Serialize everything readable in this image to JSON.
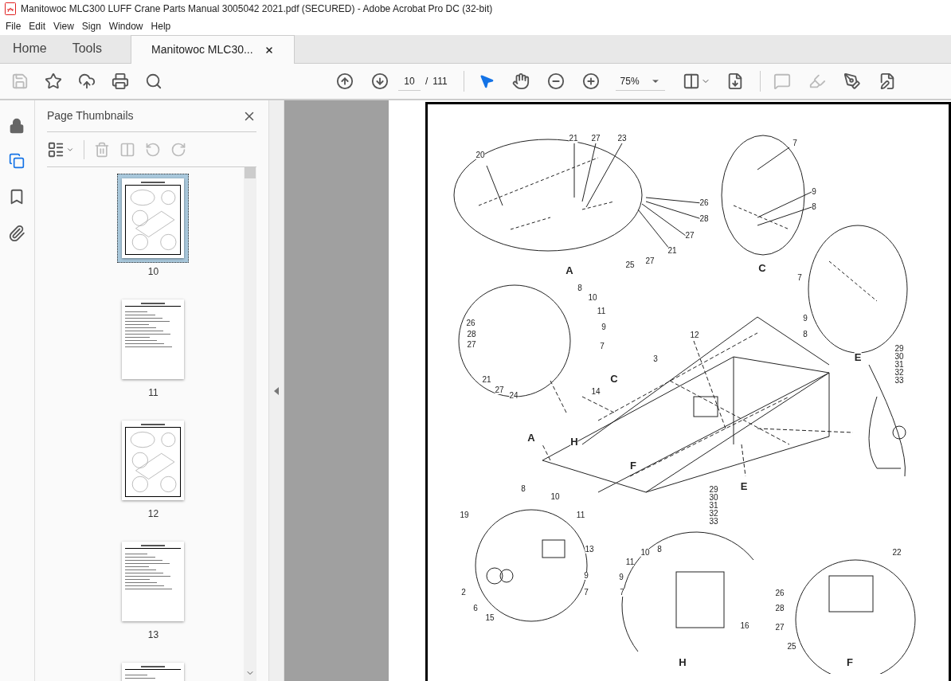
{
  "window": {
    "title": "Manitowoc MLC300 LUFF Crane Parts Manual 3005042 2021.pdf (SECURED) - Adobe Acrobat Pro DC (32-bit)"
  },
  "menu": [
    "File",
    "Edit",
    "View",
    "Sign",
    "Window",
    "Help"
  ],
  "tabs": [
    {
      "label": "Home",
      "kind": "nav",
      "selected": false
    },
    {
      "label": "Tools",
      "kind": "nav",
      "selected": false
    },
    {
      "label": "Manitowoc MLC30...",
      "kind": "document",
      "selected": true
    }
  ],
  "toolbar": {
    "page_current": "10",
    "page_separator": "/",
    "page_total": "111",
    "zoom": "75%"
  },
  "sidebar": {
    "title": "Page Thumbnails",
    "thumbnails": [
      {
        "label": "10",
        "kind": "drawing",
        "selected": true
      },
      {
        "label": "11",
        "kind": "table",
        "selected": false
      },
      {
        "label": "12",
        "kind": "drawing",
        "selected": false
      },
      {
        "label": "13",
        "kind": "table",
        "selected": false
      },
      {
        "kind": "table",
        "selected": false
      }
    ]
  },
  "document": {
    "callouts": [
      {
        "text": "20",
        "kind": "number"
      },
      {
        "text": "21",
        "kind": "number"
      },
      {
        "text": "27",
        "kind": "number"
      },
      {
        "text": "23",
        "kind": "number"
      },
      {
        "text": "26",
        "kind": "number"
      },
      {
        "text": "28",
        "kind": "number"
      },
      {
        "text": "27",
        "kind": "number"
      },
      {
        "text": "21",
        "kind": "number"
      },
      {
        "text": "27",
        "kind": "number"
      },
      {
        "text": "25",
        "kind": "number"
      },
      {
        "text": "A",
        "kind": "view"
      },
      {
        "text": "7",
        "kind": "number"
      },
      {
        "text": "9",
        "kind": "number"
      },
      {
        "text": "8",
        "kind": "number"
      },
      {
        "text": "C",
        "kind": "view"
      },
      {
        "text": "7",
        "kind": "number"
      },
      {
        "text": "9",
        "kind": "number"
      },
      {
        "text": "8",
        "kind": "number"
      },
      {
        "text": "E",
        "kind": "view"
      },
      {
        "text": "8",
        "kind": "number"
      },
      {
        "text": "10",
        "kind": "number"
      },
      {
        "text": "11",
        "kind": "number"
      },
      {
        "text": "9",
        "kind": "number"
      },
      {
        "text": "7",
        "kind": "number"
      },
      {
        "text": "26",
        "kind": "number"
      },
      {
        "text": "28",
        "kind": "number"
      },
      {
        "text": "27",
        "kind": "number"
      },
      {
        "text": "21",
        "kind": "number"
      },
      {
        "text": "27",
        "kind": "number"
      },
      {
        "text": "24",
        "kind": "number"
      },
      {
        "text": "29",
        "kind": "number"
      },
      {
        "text": "30",
        "kind": "number"
      },
      {
        "text": "31",
        "kind": "number"
      },
      {
        "text": "32",
        "kind": "number"
      },
      {
        "text": "33",
        "kind": "number"
      },
      {
        "text": "12",
        "kind": "number"
      },
      {
        "text": "3",
        "kind": "number"
      },
      {
        "text": "14",
        "kind": "number"
      },
      {
        "text": "C",
        "kind": "view"
      },
      {
        "text": "A",
        "kind": "view"
      },
      {
        "text": "H",
        "kind": "view"
      },
      {
        "text": "F",
        "kind": "view"
      },
      {
        "text": "8",
        "kind": "number"
      },
      {
        "text": "10",
        "kind": "number"
      },
      {
        "text": "29",
        "kind": "number"
      },
      {
        "text": "30",
        "kind": "number"
      },
      {
        "text": "31",
        "kind": "number"
      },
      {
        "text": "32",
        "kind": "number"
      },
      {
        "text": "33",
        "kind": "number"
      },
      {
        "text": "E",
        "kind": "view"
      },
      {
        "text": "19",
        "kind": "number"
      },
      {
        "text": "11",
        "kind": "number"
      },
      {
        "text": "13",
        "kind": "number"
      },
      {
        "text": "10",
        "kind": "number"
      },
      {
        "text": "8",
        "kind": "number"
      },
      {
        "text": "22",
        "kind": "number"
      },
      {
        "text": "11",
        "kind": "number"
      },
      {
        "text": "9",
        "kind": "number"
      },
      {
        "text": "9",
        "kind": "number"
      },
      {
        "text": "2",
        "kind": "number"
      },
      {
        "text": "7",
        "kind": "number"
      },
      {
        "text": "7",
        "kind": "number"
      },
      {
        "text": "26",
        "kind": "number"
      },
      {
        "text": "6",
        "kind": "number"
      },
      {
        "text": "28",
        "kind": "number"
      },
      {
        "text": "15",
        "kind": "number"
      },
      {
        "text": "16",
        "kind": "number"
      },
      {
        "text": "27",
        "kind": "number"
      },
      {
        "text": "25",
        "kind": "number"
      },
      {
        "text": "H",
        "kind": "view"
      },
      {
        "text": "F",
        "kind": "view"
      }
    ]
  }
}
